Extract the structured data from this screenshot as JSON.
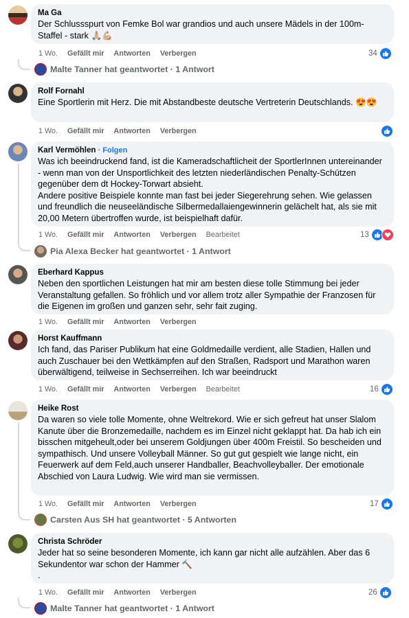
{
  "comments": [
    {
      "author": "Ma Ga",
      "text": "Der Schlussspurt von Femke Bol war grandios und auch unsere Mädels in der 100m-Staffel - stark 🙏🏼💪🏼",
      "time": "1 Wo.",
      "like_label": "Gefällt mir",
      "reply_label": "Antworten",
      "hide_label": "Verbergen",
      "reactions": "34",
      "reply_summary": "Malte Tanner hat geantwortet · 1 Antwort"
    },
    {
      "author": "Rolf Fornahl",
      "text": "Eine Sportlerin mit Herz. Die mit Abstandbeste deutsche Vertreterin Deutschlands. 😍😍",
      "time": "1 Wo.",
      "like_label": "Gefällt mir",
      "reply_label": "Antworten",
      "hide_label": "Verbergen",
      "reactions": ""
    },
    {
      "author": "Karl Vermöhlen",
      "follow": "· Folgen",
      "text": "Was ich beeindruckend fand, ist die Kameradschaftlicheit der SportlerInnen untereinander - wenn man von der Unsportlichkeit des letzten niederländischen Penalty-Schützen gegenüber dem dt Hockey-Torwart absieht.\nAndere positive Beispiele konnte man fast bei jeder Siegerehrung sehen. Wie gelassen und freundlich die neuseeländische Silbermedallaiengewinnerin gelächelt hat, als sie mit 20,00 Metern übertroffen wurde, ist beispielhaft dafür.",
      "time": "1 Wo.",
      "like_label": "Gefällt mir",
      "reply_label": "Antworten",
      "hide_label": "Verbergen",
      "edited": "Bearbeitet",
      "reactions": "13",
      "reply_summary": "Pia Alexa Becker hat geantwortet · 1 Antwort"
    },
    {
      "author": "Eberhard Kappus",
      "text": "Neben den sportlichen Leistungen hat mir am besten diese tolle Stimmung bei jeder Veranstaltung gefallen. So fröhlich und vor allem trotz aller Sympathie der Franzosen für die Eigenen im großen und ganzen sehr, sehr fait zuging.",
      "time": "1 Wo.",
      "like_label": "Gefällt mir",
      "reply_label": "Antworten",
      "hide_label": "Verbergen"
    },
    {
      "author": "Horst Kauffmann",
      "text": "Ich fand, das Pariser Publikum hat eine Goldmedaille verdient, alle Stadien, Hallen und auch Zuschauer bei den Wettkämpfen auf den Straßen, Radsport und Marathon waren überwältigend, teilweise in Sechserreihen. Ich war beeindruckt",
      "time": "1 Wo.",
      "like_label": "Gefällt mir",
      "reply_label": "Antworten",
      "hide_label": "Verbergen",
      "edited": "Bearbeitet",
      "reactions": "16"
    },
    {
      "author": "Heike Rost",
      "text": "Da waren so viele tolle Momente, ohne Weltrekord. Wie er sich gefreut hat unser Slalom Kanute über die Bronzemedaille, nachdem es im Einzel nicht geklappt hat. Da hab ich ein bisschen mitgeheult,oder bei unserem Goldjungen über 400m Freistil. So bescheiden und sympathisch. Und unsere Volleyball Männer. So gut gut gespielt wie lange nicht, ein Feuerwerk auf dem Feld,auch unserer Handballer, Beachvolleyballer. Der emotionale Abschied von Laura Ludwig. Wie wird man sie vermissen.",
      "time": "1 Wo.",
      "like_label": "Gefällt mir",
      "reply_label": "Antworten",
      "hide_label": "Verbergen",
      "reactions": "17",
      "reply_summary": "Carsten Aus SH hat geantwortet · 5 Antworten"
    },
    {
      "author": "Christa Schröder",
      "text": "Jeder hat so seine besonderen Momente, ich kann gar nicht alle aufzählen. Aber das 6 Sekundentor war schon der Hammer 🔨\n.",
      "time": "1 Wo.",
      "like_label": "Gefällt mir",
      "reply_label": "Antworten",
      "hide_label": "Verbergen",
      "reactions": "26",
      "reply_summary": "Malte Tanner hat geantwortet · 1 Antwort"
    }
  ],
  "colors": {
    "like_blue": "#1877f2",
    "love_red": "#f33e58",
    "bubble_bg": "#f0f2f5",
    "meta_gray": "#65676b"
  },
  "icons": {
    "like": "thumbs-up-icon",
    "love": "heart-icon"
  }
}
